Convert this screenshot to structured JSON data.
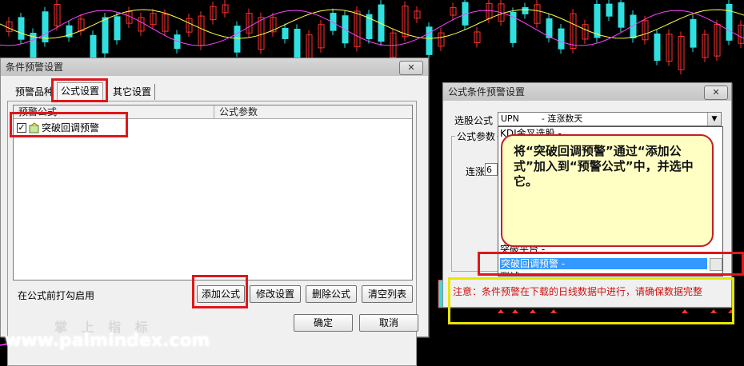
{
  "dialog_alert": {
    "title": "条件预警设置",
    "close": "✕",
    "tabs": [
      "预警品种",
      "公式设置",
      "其它设置"
    ],
    "columns": [
      "预警公式",
      "公式参数"
    ],
    "rows": [
      {
        "name": "突破回调预警",
        "checked": true
      }
    ],
    "hint": "在公式前打勾启用",
    "buttons": {
      "add": "添加公式",
      "edit": "修改设置",
      "delete": "删除公式",
      "clear": "清空列表"
    },
    "ok": "确定",
    "cancel": "取消"
  },
  "dialog_formula": {
    "title": "公式条件预警设置",
    "close": "✕",
    "select_label": "选股公式",
    "select_value": "UPN        - 连涨数天",
    "dropdown_top": "KDJ金叉选股 -",
    "params_group": "公式参数",
    "param_label": "连涨",
    "param_value": "6",
    "items_partial": [
      "突破平台 -"
    ],
    "selected_item": "突破回调预警 -",
    "item_after": "测试",
    "notice": "注意：条件预警在下载的日线数据中进行，请确保数据完整"
  },
  "callout": {
    "text": "将“突破回调预警”通过“添加公式”加入到“预警公式”中，并选中它。"
  },
  "watermark": {
    "cn": "掌 上 指 标",
    "url": "www.palmindex.com"
  },
  "colors": {
    "up": "#ff3030",
    "down": "#30e0e0",
    "ma1": "#ffff40",
    "ma2": "#ff40ff",
    "highlight": "#e0161a"
  }
}
